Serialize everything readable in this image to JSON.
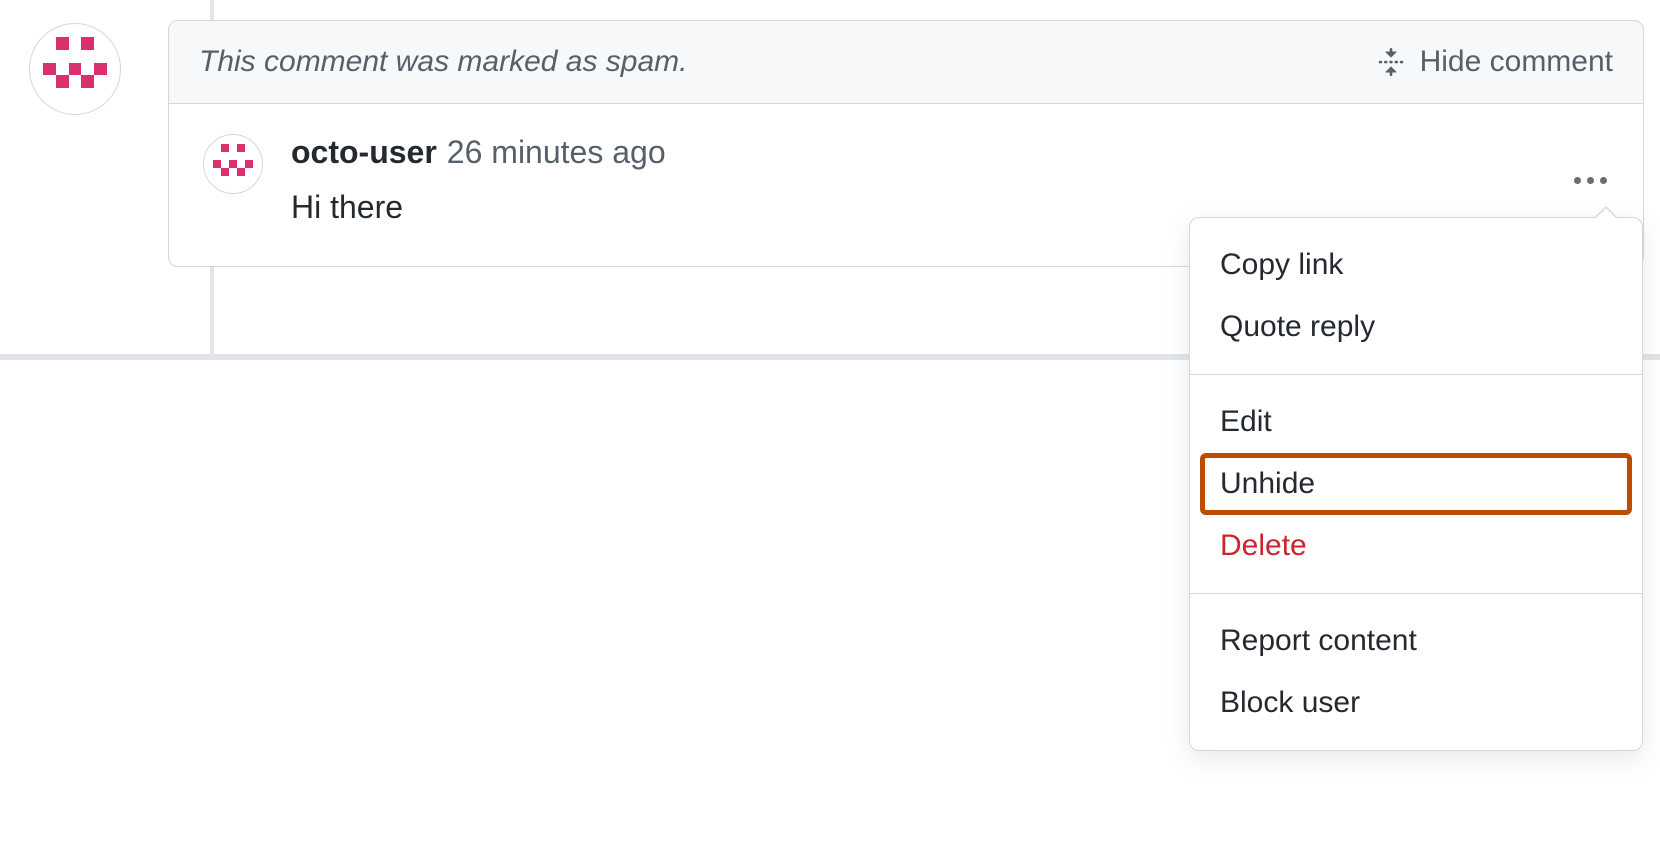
{
  "spam_banner": {
    "text": "This comment was marked as spam.",
    "hide_label": "Hide comment"
  },
  "comment": {
    "username": "octo-user",
    "timestamp": "26 minutes ago",
    "body": "Hi there"
  },
  "menu": {
    "copy_link": "Copy link",
    "quote_reply": "Quote reply",
    "edit": "Edit",
    "unhide": "Unhide",
    "delete": "Delete",
    "report_content": "Report content",
    "block_user": "Block user"
  }
}
